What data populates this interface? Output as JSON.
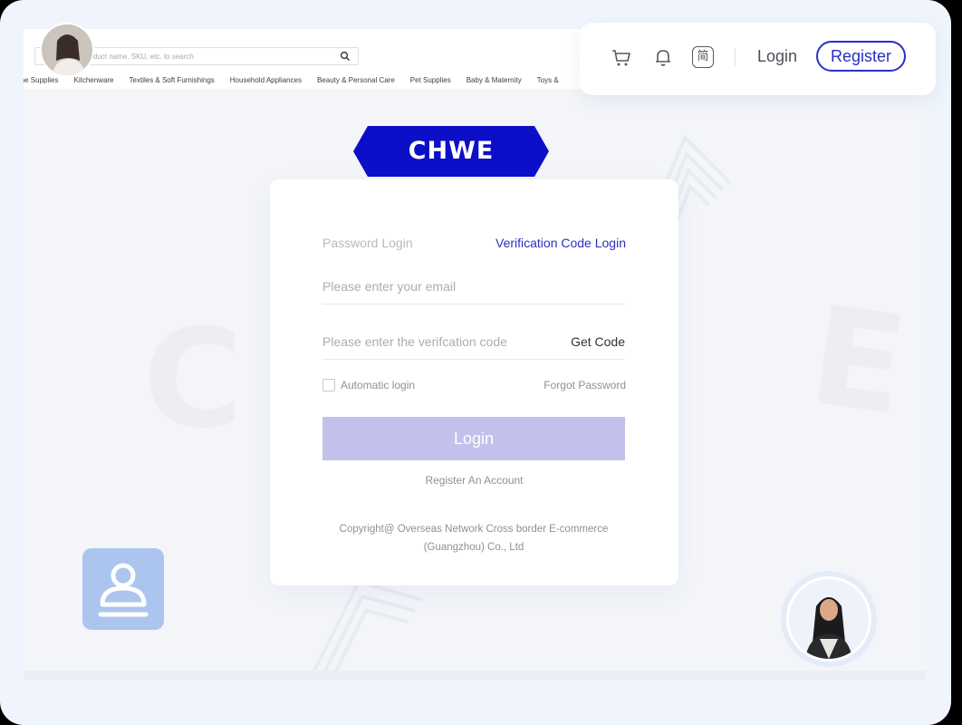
{
  "search": {
    "placeholder": "duct name, SKU, etc. to search",
    "icon": "search-icon"
  },
  "categories": [
    "ome Supplies",
    "Kitchenware",
    "Textiles & Soft Furnishings",
    "Household Appliances",
    "Beauty & Personal Care",
    "Pet Supplies",
    "Baby & Maternity",
    "Toys &"
  ],
  "topbar": {
    "icons": [
      "cart-icon",
      "bell-icon",
      "language-icon"
    ],
    "language_glyph": "简",
    "login_label": "Login",
    "register_label": "Register"
  },
  "brand": {
    "logo_text": "CHWE",
    "logo_color": "#0b0fc8"
  },
  "login_form": {
    "tab_password": "Password Login",
    "tab_verification": "Verification Code Login",
    "email_placeholder": "Please enter your email",
    "code_placeholder": "Please enter the verifcation code",
    "get_code_label": "Get Code",
    "auto_login_label": "Automatic login",
    "forgot_password_label": "Forgot Password",
    "login_button_label": "Login",
    "register_link": "Register An Account",
    "copyright_line1": "Copyright@ Overseas Network Cross border E-commerce",
    "copyright_line2": "(Guangzhou) Co., Ltd"
  },
  "colors": {
    "accent": "#2a2fc3",
    "login_button_disabled": "#c2c1ec",
    "user_tile": "#abc5ee",
    "background": "#f0f5fd"
  }
}
